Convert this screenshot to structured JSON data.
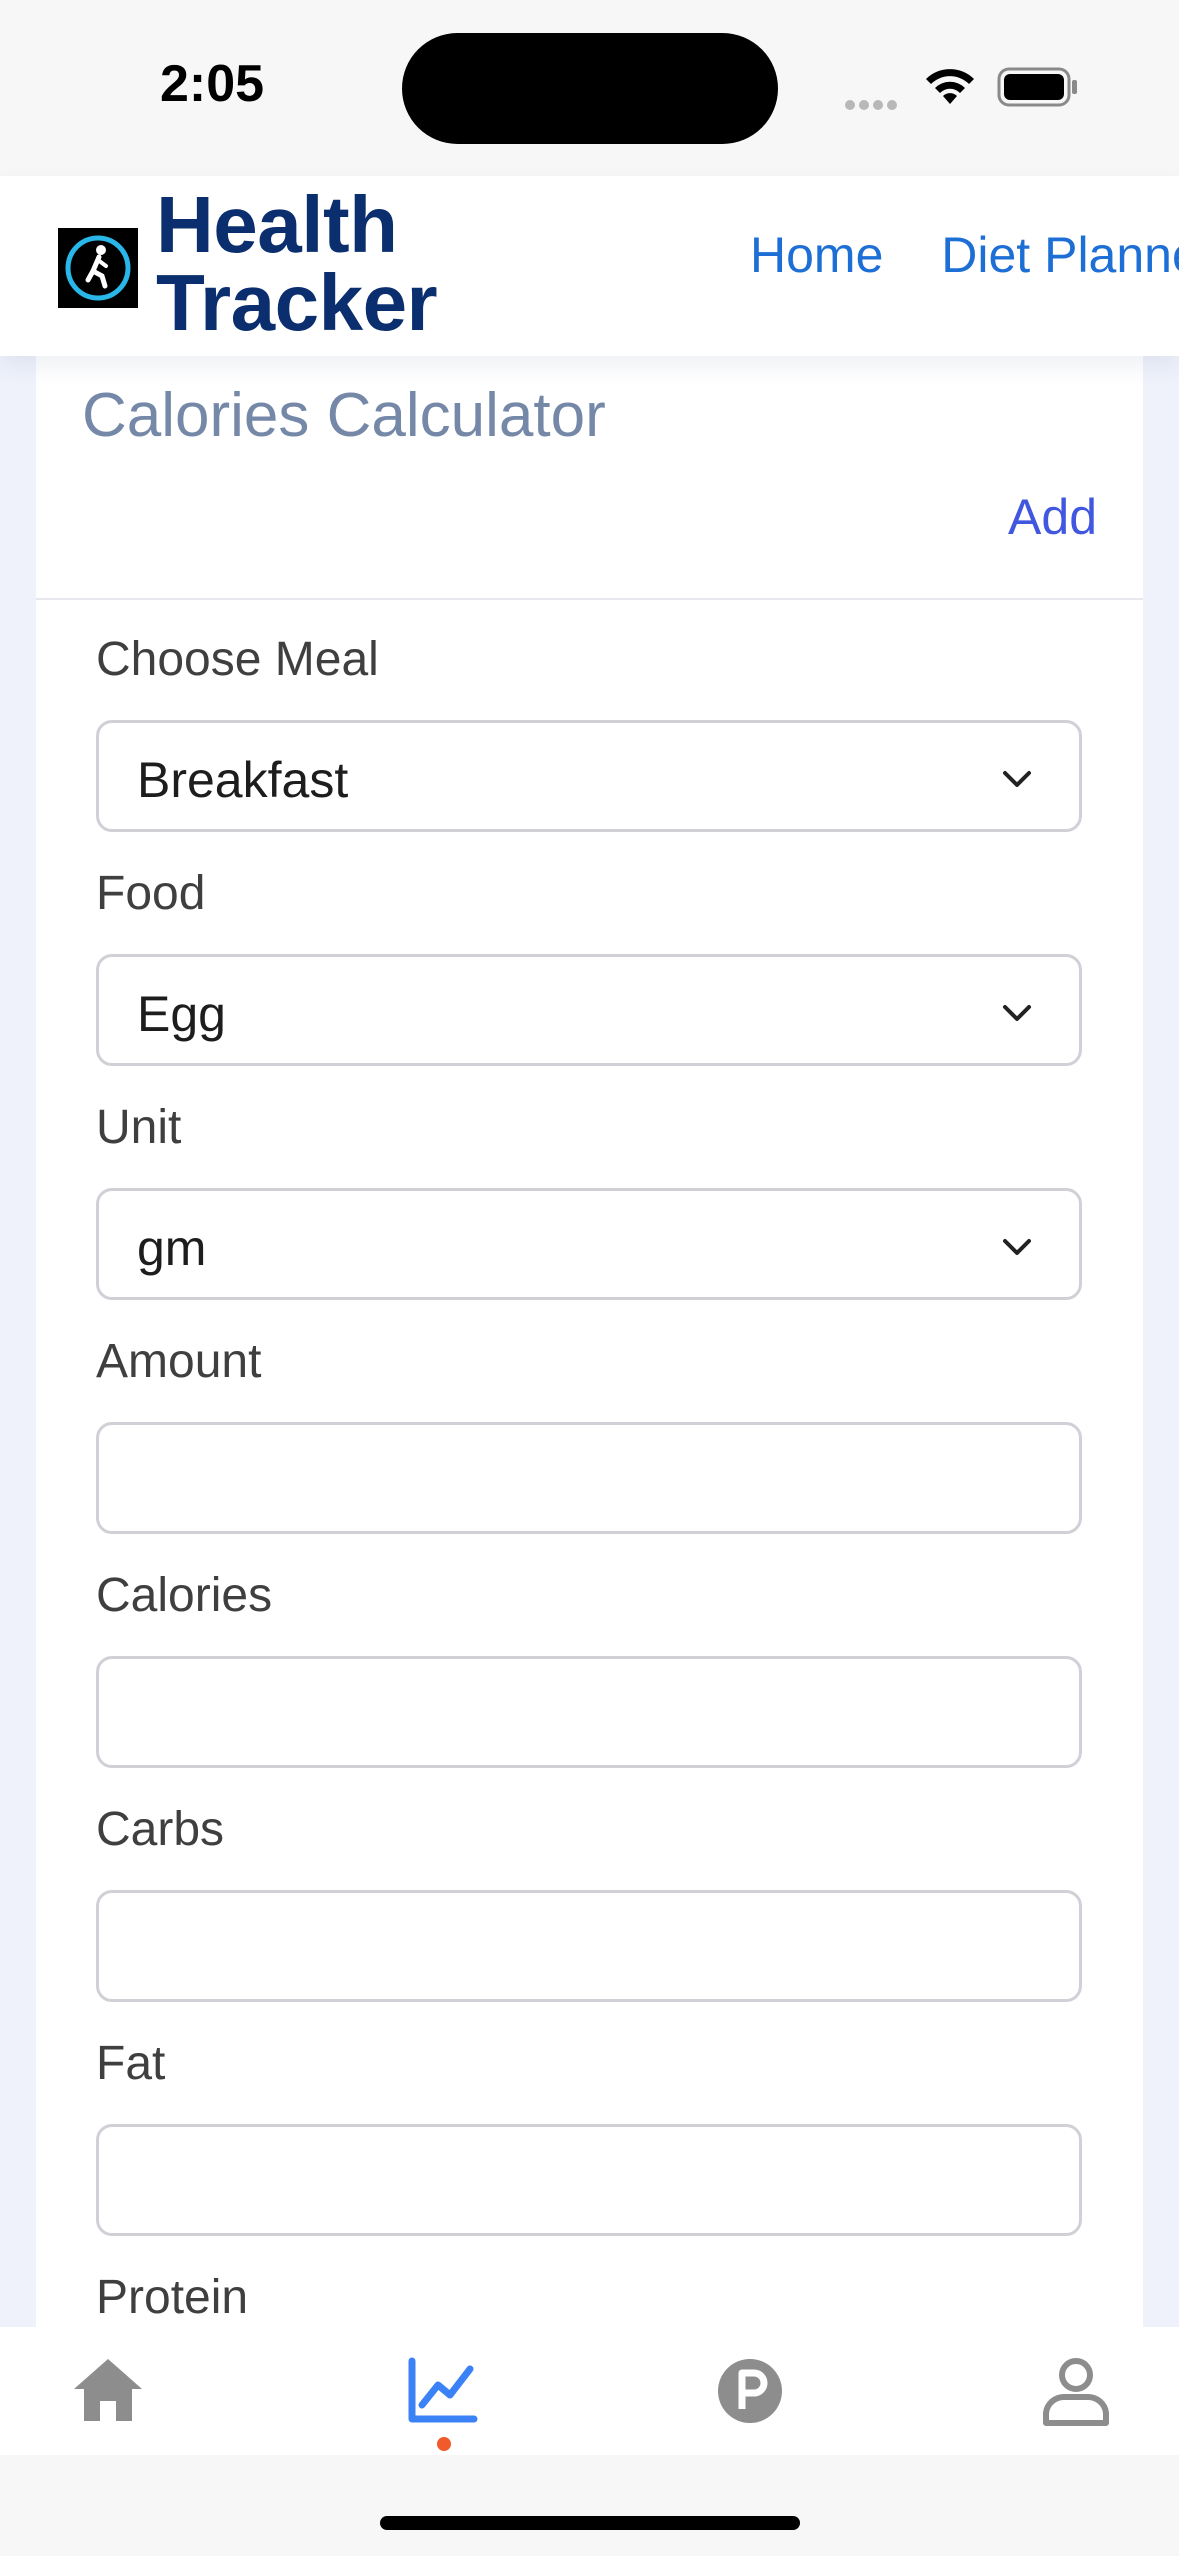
{
  "status_bar": {
    "time": "2:05"
  },
  "header": {
    "brand_line1": "Health",
    "brand_line2": "Tracker",
    "logo_icon": "walking-person-icon",
    "nav": [
      {
        "label": "Home"
      },
      {
        "label": "Diet Planner"
      }
    ]
  },
  "card": {
    "title": "Calories Calculator",
    "action_label": "Add"
  },
  "form": {
    "meal": {
      "label": "Choose Meal",
      "value": "Breakfast"
    },
    "food": {
      "label": "Food",
      "value": "Egg"
    },
    "unit": {
      "label": "Unit",
      "value": "gm"
    },
    "amount": {
      "label": "Amount",
      "value": ""
    },
    "calories": {
      "label": "Calories",
      "value": ""
    },
    "carbs": {
      "label": "Carbs",
      "value": ""
    },
    "fat": {
      "label": "Fat",
      "value": ""
    },
    "protein": {
      "label": "Protein"
    }
  },
  "tab_bar": {
    "tabs": [
      {
        "icon": "home-icon",
        "active": false
      },
      {
        "icon": "chart-icon",
        "active": true
      },
      {
        "icon": "parking-icon",
        "active": false
      },
      {
        "icon": "profile-icon",
        "active": false
      }
    ]
  },
  "colors": {
    "brand": "#0a2e6e",
    "nav_link": "#1d6fd6",
    "accent": "#4257e0",
    "active_tab": "#3b82f6",
    "inactive_tab": "#8d8d8d",
    "tab_dot": "#f15a2b",
    "page_bg": "#eff2fb"
  }
}
